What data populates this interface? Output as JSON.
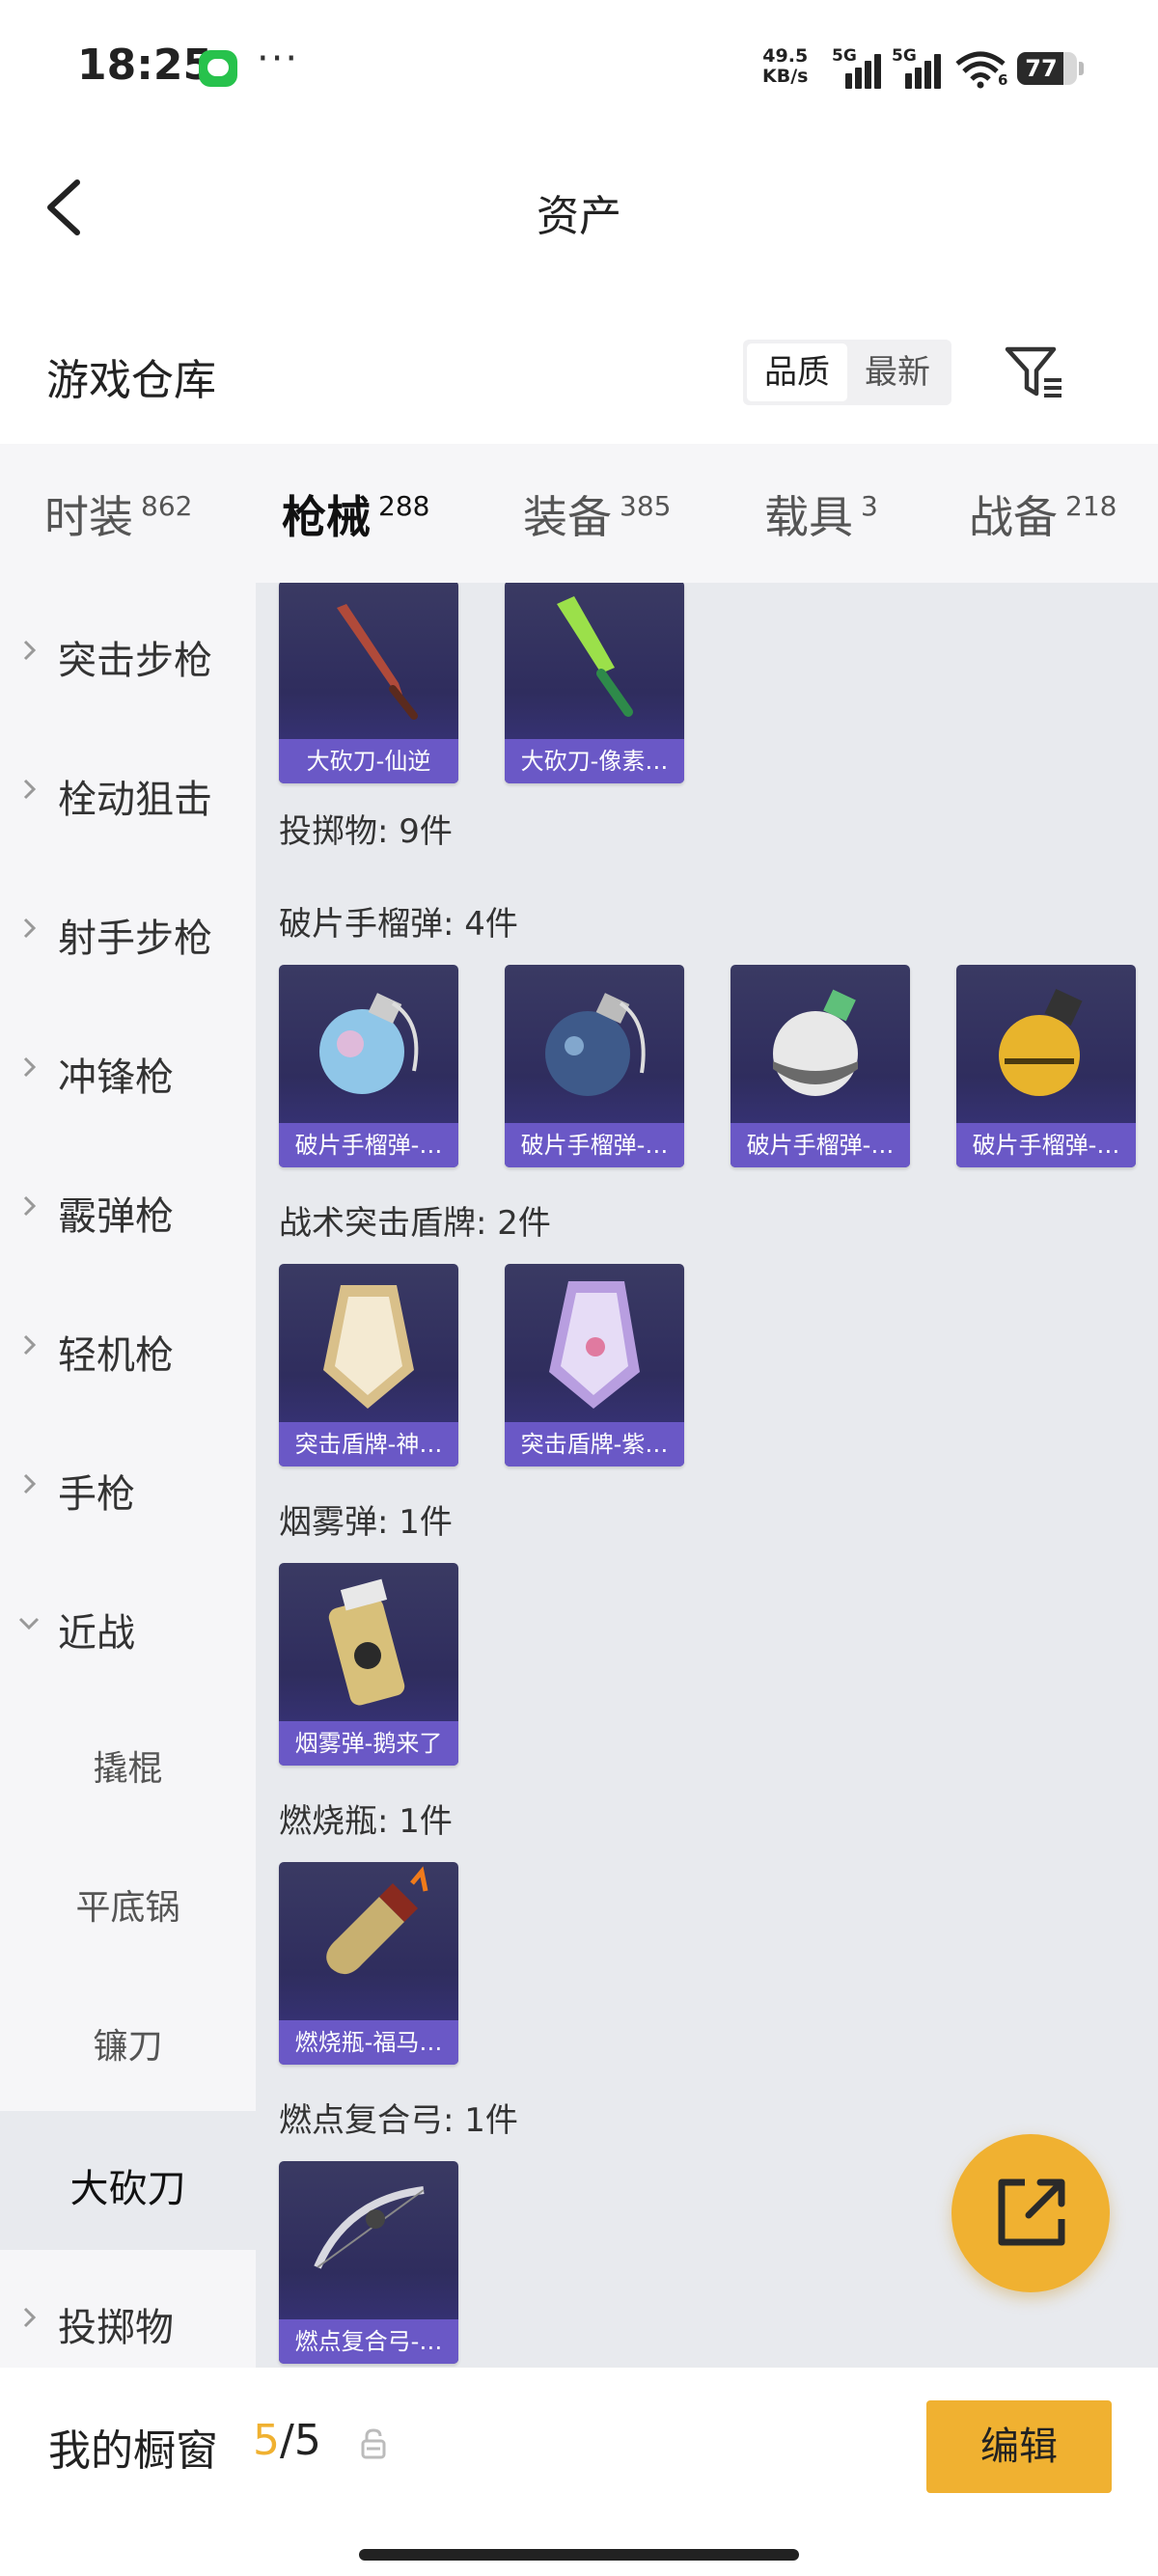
{
  "status_bar": {
    "time": "18:25",
    "more": "···",
    "net_speed_value": "49.5",
    "net_speed_unit": "KB/s",
    "signal_1_label": "5G",
    "signal_2_label": "5G",
    "wifi_label": "6",
    "battery_level": "77"
  },
  "header": {
    "title": "资产"
  },
  "warehouse": {
    "title": "游戏仓库",
    "sort_options": [
      "品质",
      "最新"
    ],
    "active_sort": "品质"
  },
  "category_tabs": [
    {
      "label": "时装",
      "count": "862",
      "active": false
    },
    {
      "label": "枪械",
      "count": "288",
      "active": true
    },
    {
      "label": "装备",
      "count": "385",
      "active": false
    },
    {
      "label": "载具",
      "count": "3",
      "active": false
    },
    {
      "label": "战备",
      "count": "218",
      "active": false
    }
  ],
  "sidebar": {
    "items": [
      {
        "label": "突击步枪",
        "type": "collapsed"
      },
      {
        "label": "栓动狙击",
        "type": "collapsed"
      },
      {
        "label": "射手步枪",
        "type": "collapsed"
      },
      {
        "label": "冲锋枪",
        "type": "collapsed"
      },
      {
        "label": "霰弹枪",
        "type": "collapsed"
      },
      {
        "label": "轻机枪",
        "type": "collapsed"
      },
      {
        "label": "手枪",
        "type": "collapsed"
      },
      {
        "label": "近战",
        "type": "expanded"
      },
      {
        "label": "撬棍",
        "type": "sub"
      },
      {
        "label": "平底锅",
        "type": "sub"
      },
      {
        "label": "镰刀",
        "type": "sub"
      },
      {
        "label": "大砍刀",
        "type": "selected"
      },
      {
        "label": "投掷物",
        "type": "collapsed"
      }
    ]
  },
  "content": {
    "top_items": [
      {
        "caption": "大砍刀-仙逆",
        "icon": "machete-red-icon"
      },
      {
        "caption": "大砍刀-像素…",
        "icon": "machete-green-icon"
      }
    ],
    "sections": [
      {
        "heading": "投掷物: 9件",
        "items": []
      },
      {
        "heading": "破片手榴弹: 4件",
        "items": [
          {
            "caption": "破片手榴弹-…",
            "icon": "grenade-blue-icon"
          },
          {
            "caption": "破片手榴弹-…",
            "icon": "grenade-dark-icon"
          },
          {
            "caption": "破片手榴弹-…",
            "icon": "grenade-white-icon"
          },
          {
            "caption": "破片手榴弹-…",
            "icon": "grenade-gold-icon"
          }
        ]
      },
      {
        "heading": "战术突击盾牌: 2件",
        "items": [
          {
            "caption": "突击盾牌-神…",
            "icon": "shield-gold-icon"
          },
          {
            "caption": "突击盾牌-紫…",
            "icon": "shield-purple-icon"
          }
        ]
      },
      {
        "heading": "烟雾弹: 1件",
        "items": [
          {
            "caption": "烟雾弹-鹅来了",
            "icon": "smoke-grenade-icon"
          }
        ]
      },
      {
        "heading": "燃烧瓶: 1件",
        "items": [
          {
            "caption": "燃烧瓶-福马…",
            "icon": "molotov-icon"
          }
        ]
      },
      {
        "heading": "燃点复合弓: 1件",
        "items": [
          {
            "caption": "燃点复合弓-…",
            "icon": "compound-bow-icon"
          }
        ]
      }
    ]
  },
  "bottom_bar": {
    "window_label": "我的橱窗",
    "window_current": "5",
    "window_total": "/5",
    "edit_label": "编辑"
  },
  "colors": {
    "accent": "#f0b131",
    "card_caption": "#6a58c6",
    "card_bg": "#2f2d5e",
    "content_bg": "#e8eaee",
    "sidebar_bg": "#f6f6f8"
  }
}
